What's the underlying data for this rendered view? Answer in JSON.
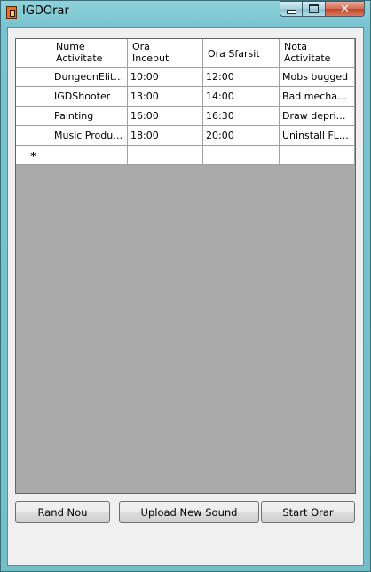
{
  "window": {
    "title": "IGDOrar",
    "minimize_glyph": "",
    "maximize_glyph": "",
    "close_glyph": "✕"
  },
  "grid": {
    "columns": [
      {
        "line1": "Nume",
        "line2": "Activitate"
      },
      {
        "line1": "Ora",
        "line2": "Inceput"
      },
      {
        "line1": "Ora Sfarsit",
        "line2": ""
      },
      {
        "line1": "Nota",
        "line2": "Activitate"
      }
    ],
    "rows": [
      [
        "DungeonElites...",
        "10:00",
        "12:00",
        "Mobs bugged"
      ],
      [
        "IGDShooter",
        "13:00",
        "14:00",
        "Bad mechanics"
      ],
      [
        "Painting",
        "16:00",
        "16:30",
        "Draw deprimus"
      ],
      [
        "Music Produci...",
        "18:00",
        "20:00",
        "Uninstall FLSt..."
      ]
    ],
    "new_row_marker": "*"
  },
  "buttons": {
    "rand_nou": "Rand Nou",
    "upload": "Upload New Sound",
    "start": "Start Orar"
  },
  "colors": {
    "titlebar": "#78c3cf",
    "grid_empty": "#aaaaaa",
    "close_button": "#c5452b"
  }
}
